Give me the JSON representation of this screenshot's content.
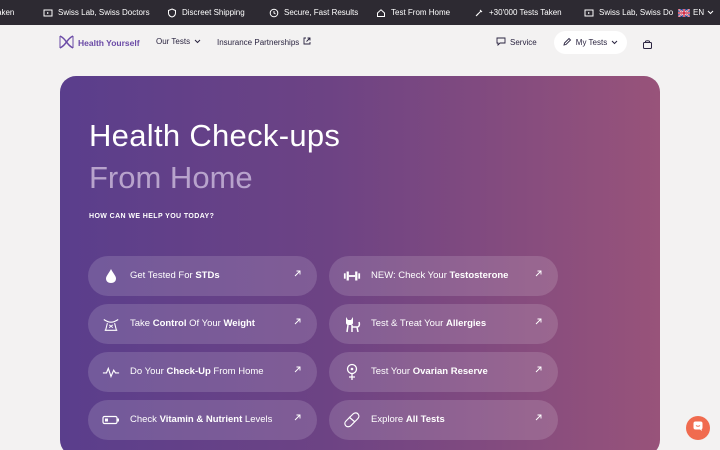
{
  "ticker": {
    "items": [
      "aken",
      "Swiss Lab, Swiss Doctors",
      "Discreet Shipping",
      "Secure, Fast Results",
      "Test From Home",
      "+30'000 Tests Taken",
      "Swiss Lab, Swiss Do"
    ],
    "lang": "EN"
  },
  "nav": {
    "logo": "Health Yourself",
    "our_tests": "Our Tests",
    "insurance": "Insurance Partnerships",
    "service": "Service",
    "my_tests": "My Tests"
  },
  "hero": {
    "title": "Health Check-ups",
    "subtitle": "From Home",
    "question": "HOW CAN WE HELP YOU TODAY?",
    "options": [
      {
        "pre": "Get Tested For ",
        "bold": "STDs",
        "post": ""
      },
      {
        "pre": "NEW: Check Your ",
        "bold": "Testosterone",
        "post": ""
      },
      {
        "pre": "Take ",
        "bold": "Control",
        "mid": " Of Your ",
        "bold2": "Weight",
        "post": ""
      },
      {
        "pre": "Test & Treat Your ",
        "bold": "Allergies",
        "post": ""
      },
      {
        "pre": "Do Your ",
        "bold": "Check-Up",
        "post": " From Home"
      },
      {
        "pre": "Test Your ",
        "bold": "Ovarian Reserve",
        "post": ""
      },
      {
        "pre": "Check ",
        "bold": "Vitamin & Nutrient",
        "post": " Levels"
      },
      {
        "pre": "Explore ",
        "bold": "All Tests",
        "post": ""
      }
    ]
  },
  "colors": {
    "ticker_bg": "#2d2a32",
    "brand_purple": "#6a4aa6",
    "hero_gradient_start": "#5a3e8c",
    "hero_gradient_end": "#98537a",
    "chat_button": "#f06b4f"
  },
  "icons": [
    "box-icon",
    "shield-icon",
    "clock-icon",
    "home-icon",
    "syringe-icon",
    "chevron-down-icon",
    "external-link-icon",
    "chat-icon",
    "pencil-icon",
    "bag-icon",
    "drop-icon",
    "dumbbell-icon",
    "scale-icon",
    "cat-icon",
    "heartbeat-icon",
    "female-icon",
    "battery-icon",
    "pill-icon",
    "arrow-up-right-icon",
    "messenger-icon"
  ]
}
